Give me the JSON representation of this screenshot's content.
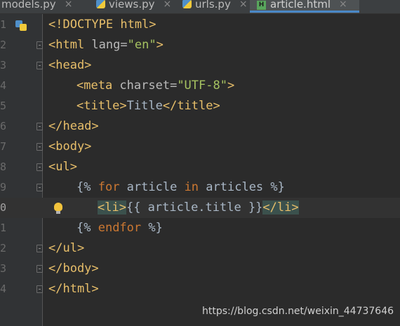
{
  "tabs": [
    {
      "label": "models.py",
      "icon": "python-file-icon"
    },
    {
      "label": "views.py",
      "icon": "python-file-icon"
    },
    {
      "label": "urls.py",
      "icon": "python-file-icon"
    },
    {
      "label": "article.html",
      "icon": "html-file-icon",
      "active": true
    }
  ],
  "tab_close_glyph": "×",
  "html_icon_letter": "H",
  "editor": {
    "line_numbers": [
      "1",
      "2",
      "3",
      "4",
      "5",
      "6",
      "7",
      "8",
      "9",
      "0",
      "1",
      "2",
      "3",
      "4"
    ],
    "code": {
      "l1": "<!DOCTYPE html>",
      "l2_tag_open": "<html",
      "l2_attr": " lang=",
      "l2_value": "\"en\"",
      "l2_tag_close": ">",
      "l3": "<head>",
      "l4_tag_open": "<meta",
      "l4_attr": " charset=",
      "l4_value": "\"UTF-8\"",
      "l4_tag_close": ">",
      "l5_open": "<title>",
      "l5_text": "Title",
      "l5_close": "</title>",
      "l6": "</head>",
      "l7": "<body>",
      "l8": "<ul>",
      "l9_a": "{% ",
      "l9_for": "for",
      "l9_b": " article ",
      "l9_in": "in",
      "l9_c": " articles %}",
      "l10_open": "<li>",
      "l10_text": "{{ article.title }}",
      "l10_close": "</li>",
      "l11_a": "{% ",
      "l11_endfor": "endfor",
      "l11_b": " %}",
      "l12": "</ul>",
      "l13": "</body>",
      "l14": "</html>"
    }
  },
  "watermark": "https://blog.csdn.net/weixin_44737646",
  "colors": {
    "background": "#2b2b2b",
    "gutter": "#313335",
    "tag": "#e8bf6a",
    "string": "#a5c261",
    "keyword": "#cc7832",
    "text": "#a9b7c6",
    "active_tab_underline": "#4a88c7"
  }
}
